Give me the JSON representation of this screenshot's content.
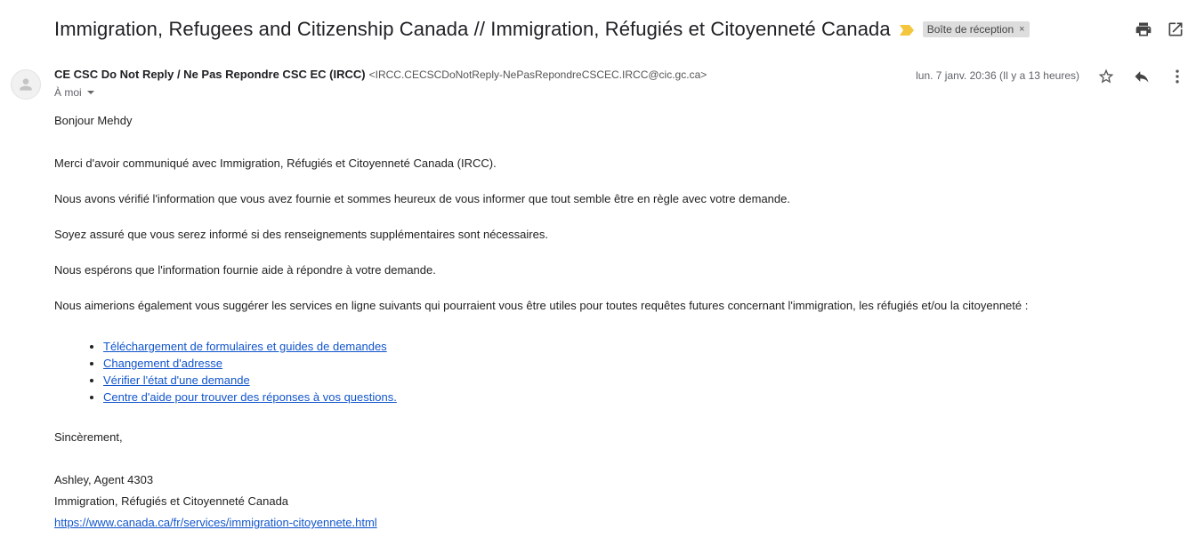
{
  "subject": "Immigration, Refugees and Citizenship Canada // Immigration, Réfugiés et Citoyenneté Canada",
  "label": "Boîte de réception",
  "label_close": "×",
  "colors": {
    "importance": "#f4c63d",
    "link": "#1155cc"
  },
  "sender": {
    "name": "CE CSC Do Not Reply / Ne Pas Repondre CSC EC (IRCC)",
    "email": "<IRCC.CECSCDoNotReply-NePasRepondreCSCEC.IRCC@cic.gc.ca>",
    "recipient": "À moi",
    "date": "lun. 7 janv. 20:36 (Il y a 13 heures)"
  },
  "icons": [
    "print-icon",
    "open-new-window-icon",
    "star-icon",
    "reply-icon",
    "more-vert-icon",
    "avatar-person-icon",
    "importance-marker-icon"
  ],
  "body": {
    "greeting": "Bonjour Mehdy",
    "p1": "Merci d'avoir communiqué avec Immigration, Réfugiés et Citoyenneté Canada (IRCC).",
    "p2": "Nous avons vérifié l'information que vous avez fournie et sommes heureux de vous informer que tout semble être en règle avec votre demande.",
    "p3": "Soyez assuré que vous serez informé si des renseignements supplémentaires sont nécessaires.",
    "p4": "Nous espérons que l'information fournie aide à répondre à votre demande.",
    "p5": "Nous aimerions également vous suggérer les services en ligne suivants qui pourraient vous être utiles pour toutes requêtes futures concernant l'immigration, les réfugiés et/ou la citoyenneté :",
    "links": [
      "Téléchargement de formulaires et guides de demandes",
      "Changement d'adresse",
      "Vérifier l'état d'une demande",
      "Centre d'aide pour trouver des réponses à vos questions."
    ],
    "closing": "Sincèrement,",
    "signature_name": "Ashley, Agent 4303",
    "signature_org": "Immigration, Réfugiés et Citoyenneté Canada",
    "signature_url": "https://www.canada.ca/fr/services/immigration-citoyennete.html"
  }
}
